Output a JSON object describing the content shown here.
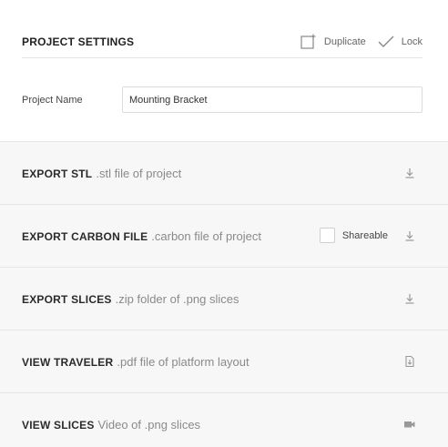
{
  "header": {
    "title": "PROJECT SETTINGS",
    "duplicate_label": "Duplicate",
    "lock_label": "Lock"
  },
  "project": {
    "name_label": "Project Name",
    "name_value": "Mounting Bracket"
  },
  "rows": [
    {
      "title": "EXPORT STL",
      "desc": ".stl file of project",
      "icon": "download-icon"
    },
    {
      "title": "EXPORT CARBON FILE",
      "desc": ".carbon file of project",
      "icon": "download-icon",
      "shareable_label": "Shareable",
      "shareable_checked": false
    },
    {
      "title": "EXPORT SLICES",
      "desc": ".zip folder of .png slices",
      "icon": "download-icon"
    },
    {
      "title": "VIEW TRAVELER",
      "desc": ".pdf file of platform layout",
      "icon": "document-icon"
    },
    {
      "title": "VIEW SLICES",
      "desc": "Video of .png slices",
      "icon": "video-camera-icon"
    }
  ],
  "colors": {
    "row_bg": "#f7f7f7",
    "divider": "#e6e6e6",
    "icon": "#999999"
  }
}
